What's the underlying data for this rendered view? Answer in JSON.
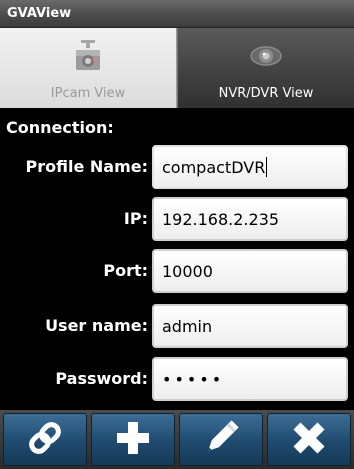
{
  "app": {
    "title": "GVAView"
  },
  "tabs": [
    {
      "label": "IPcam View",
      "icon": "ip-camera-icon",
      "selected": false
    },
    {
      "label": "NVR/DVR View",
      "icon": "eye-icon",
      "selected": true
    }
  ],
  "form": {
    "section_label": "Connection:",
    "profile_name": {
      "label": "Profile Name:",
      "value": "compactDVR"
    },
    "ip": {
      "label": "IP:",
      "value": "192.168.2.235"
    },
    "port": {
      "label": "Port:",
      "value": "10000"
    },
    "user_name": {
      "label": "User name:",
      "value": "admin"
    },
    "password": {
      "label": "Password:",
      "value": "•••••"
    }
  },
  "toolbar": {
    "buttons": [
      {
        "icon": "link-icon"
      },
      {
        "icon": "plus-icon"
      },
      {
        "icon": "pencil-icon"
      },
      {
        "icon": "close-icon"
      }
    ]
  },
  "colors": {
    "toolbar_button": "#2a5a82",
    "selected_tab": "#3c3c3c",
    "unselected_tab": "#e6e6e6"
  }
}
